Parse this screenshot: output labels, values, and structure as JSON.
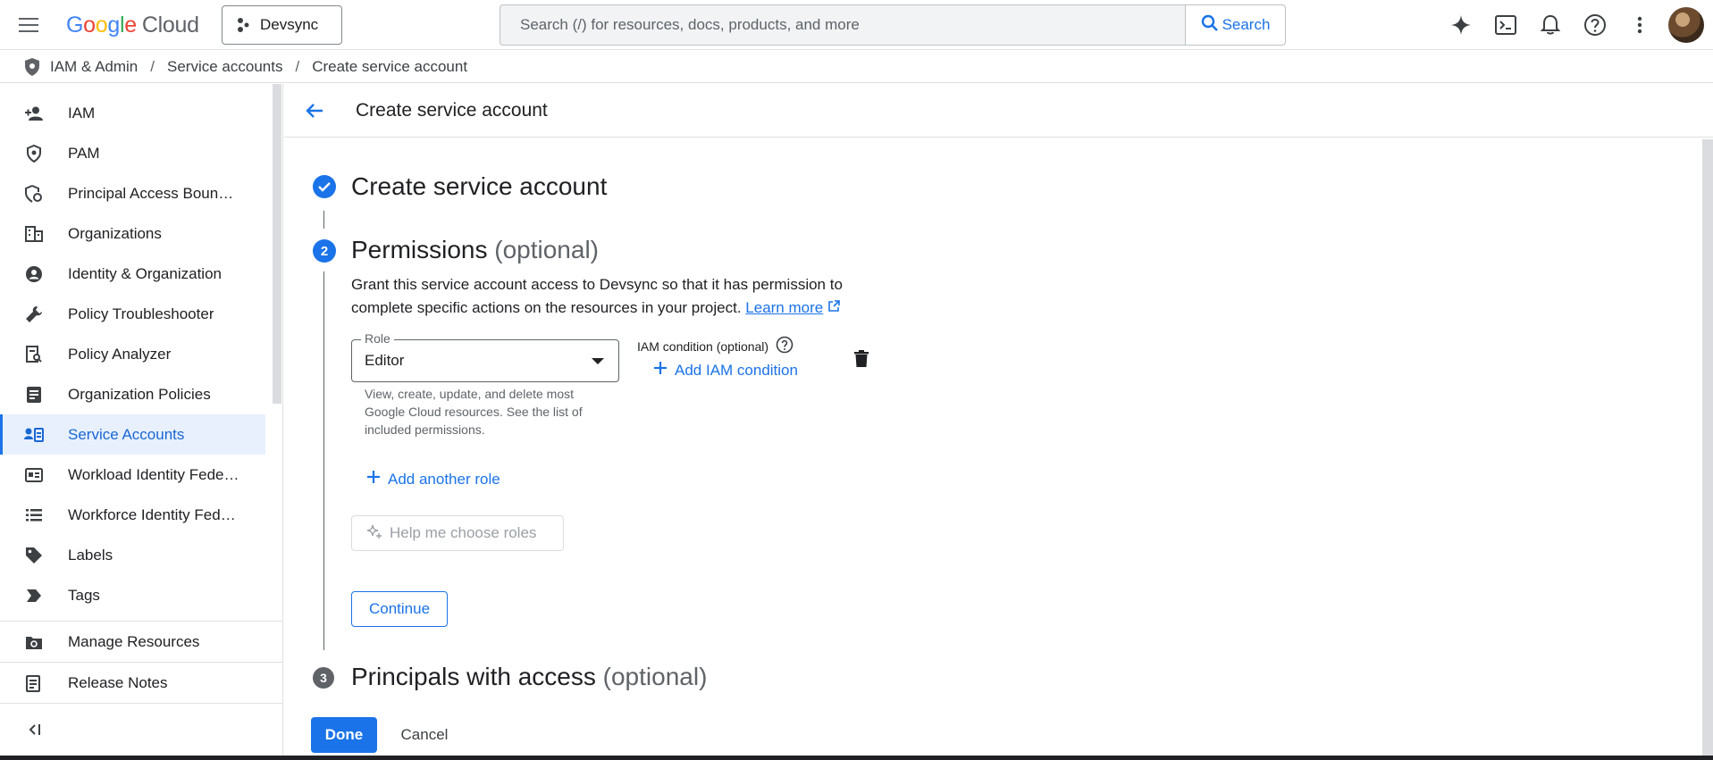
{
  "app": {
    "logo_letters": [
      "G",
      "o",
      "o",
      "g",
      "l",
      "e"
    ],
    "logo_suffix": "Cloud",
    "project": "Devsync",
    "search_placeholder": "Search (/) for resources, docs, products, and more",
    "search_button": "Search",
    "top_icons": [
      "gemini-sparkle-icon",
      "cloud-shell-icon",
      "notifications-bell-icon",
      "help-icon",
      "more-vert-icon",
      "account-avatar"
    ]
  },
  "breadcrumb": {
    "items": [
      "IAM & Admin",
      "Service accounts",
      "Create service account"
    ],
    "separator": "/"
  },
  "sidebar": {
    "items": [
      {
        "label": "IAM",
        "icon": "person-add-icon"
      },
      {
        "label": "PAM",
        "icon": "shield-check-icon"
      },
      {
        "label": "Principal Access Boun…",
        "icon": "shield-settings-icon"
      },
      {
        "label": "Organizations",
        "icon": "building-icon"
      },
      {
        "label": "Identity & Organization",
        "icon": "account-circle-icon"
      },
      {
        "label": "Policy Troubleshooter",
        "icon": "wrench-icon"
      },
      {
        "label": "Policy Analyzer",
        "icon": "document-search-icon"
      },
      {
        "label": "Organization Policies",
        "icon": "policy-list-icon"
      },
      {
        "label": "Service Accounts",
        "icon": "service-account-icon",
        "active": true
      },
      {
        "label": "Workload Identity Fede…",
        "icon": "id-card-icon"
      },
      {
        "label": "Workforce Identity Fed…",
        "icon": "list-icon"
      },
      {
        "label": "Labels",
        "icon": "label-tag-icon"
      },
      {
        "label": "Tags",
        "icon": "tag-arrow-icon"
      }
    ],
    "bottom_items": [
      {
        "label": "Manage Resources",
        "icon": "manage-resources-icon"
      },
      {
        "label": "Release Notes",
        "icon": "release-notes-icon"
      }
    ]
  },
  "main": {
    "header_title": "Create service account",
    "step1": {
      "title": "Create service account",
      "status": "completed"
    },
    "step2": {
      "number": "2",
      "title": "Permissions",
      "optional": "(optional)",
      "description": "Grant this service account access to Devsync so that it has permission to complete specific actions on the resources in your project.",
      "learn_more": "Learn more",
      "role_label": "Role",
      "role_value": "Editor",
      "role_help": "View, create, update, and delete most Google Cloud resources. See the list of included permissions.",
      "iam_condition_label": "IAM condition (optional)",
      "add_iam_condition": "Add IAM condition",
      "add_another_role": "Add another role",
      "help_choose_roles": "Help me choose roles",
      "continue": "Continue"
    },
    "step3": {
      "number": "3",
      "title": "Principals with access",
      "optional": "(optional)"
    },
    "done": "Done",
    "cancel": "Cancel"
  },
  "colors": {
    "accent": "#1a73e8",
    "active_bg": "#e8f0fe",
    "muted": "#5f6368"
  }
}
